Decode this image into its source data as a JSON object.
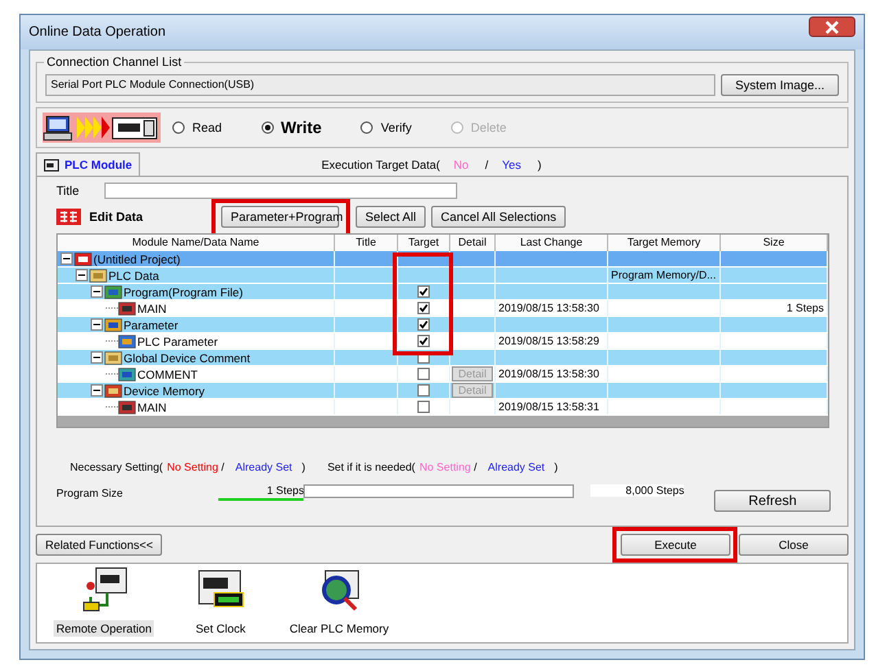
{
  "window": {
    "title": "Online Data Operation"
  },
  "connection": {
    "legend": "Connection Channel List",
    "value": "Serial Port  PLC Module Connection(USB)",
    "button": "System Image..."
  },
  "modes": [
    {
      "label": "Read",
      "selected": false,
      "disabled": false
    },
    {
      "label": "Write",
      "selected": true,
      "disabled": false
    },
    {
      "label": "Verify",
      "selected": false,
      "disabled": false
    },
    {
      "label": "Delete",
      "selected": false,
      "disabled": true
    }
  ],
  "tabs": [
    {
      "label": "PLC Module",
      "selected": true
    }
  ],
  "execution_target": {
    "label": "Execution Target Data(",
    "no": "No",
    "separator": "/",
    "yes": "Yes",
    "close": ")"
  },
  "title_field": {
    "label": "Title"
  },
  "edit_data": {
    "label": "Edit Data"
  },
  "edit_buttons": [
    {
      "label": "Parameter+Program",
      "highlighted": true
    },
    {
      "label": "Select All",
      "highlighted": false
    },
    {
      "label": "Cancel All Selections",
      "highlighted": false
    }
  ],
  "table": {
    "columns": [
      {
        "label": "Module Name/Data Name",
        "highlighted": false
      },
      {
        "label": "Title",
        "highlighted": false
      },
      {
        "label": "Target",
        "highlighted": true
      },
      {
        "label": "Detail",
        "highlighted": false
      },
      {
        "label": "Last Change",
        "highlighted": false
      },
      {
        "label": "Target Memory",
        "highlighted": false
      },
      {
        "label": "Size",
        "highlighted": false
      }
    ],
    "rows": [
      {
        "name": "(Untitled Project)",
        "kind": "project",
        "expanded": true,
        "selected": true,
        "children": [
          {
            "name": "PLC Data",
            "kind": "folder",
            "expanded": true,
            "selected": false,
            "target_memory": "Program Memory/D...",
            "children": [
              {
                "name": "Program(Program File)",
                "kind": "program",
                "expanded": true,
                "selected": false,
                "target": true,
                "children": [
                  {
                    "name": "MAIN",
                    "kind": "program_file",
                    "selected": false,
                    "target": true,
                    "last_change": "2019/08/15 13:58:30",
                    "size": "1 Steps"
                  }
                ]
              },
              {
                "name": "Parameter",
                "kind": "parameter",
                "expanded": true,
                "selected": false,
                "target": true,
                "children": [
                  {
                    "name": "PLC Parameter",
                    "kind": "parameter_file",
                    "selected": false,
                    "target": true,
                    "last_change": "2019/08/15 13:58:29"
                  }
                ]
              },
              {
                "name": "Global Device Comment",
                "kind": "comment",
                "expanded": true,
                "selected": false,
                "target": false,
                "children": [
                  {
                    "name": "COMMENT",
                    "kind": "comment_file",
                    "selected": false,
                    "target": false,
                    "detail": "Detail",
                    "last_change": "2019/08/15 13:58:30"
                  }
                ]
              },
              {
                "name": "Device Memory",
                "kind": "memory",
                "expanded": true,
                "selected": false,
                "target": false,
                "detail": "Detail",
                "children": [
                  {
                    "name": "MAIN",
                    "kind": "memory_file",
                    "selected": false,
                    "target": false,
                    "last_change": "2019/08/15 13:58:31"
                  }
                ]
              }
            ]
          }
        ]
      }
    ]
  },
  "legends": [
    {
      "label": "Necessary Setting(",
      "no_setting": "No Setting",
      "color": "#ff0000",
      "separator": "/",
      "already_set": "Already Set",
      "close": ")"
    },
    {
      "label": "Set if it is needed(",
      "no_setting": "No Setting",
      "color": "#ff66cc",
      "separator": "/",
      "already_set": "Already Set",
      "close": ")"
    }
  ],
  "program_size": {
    "label": "Program Size",
    "used": "1 Steps",
    "capacity": "8,000 Steps"
  },
  "refresh": "Refresh",
  "related": "Related Functions<<",
  "footer_buttons": [
    {
      "label": "Execute",
      "highlighted": true
    },
    {
      "label": "Close",
      "highlighted": false
    }
  ],
  "functions": [
    {
      "label": "Remote Operation",
      "kind": "remote",
      "selected": true
    },
    {
      "label": "Set Clock",
      "kind": "clock",
      "selected": false
    },
    {
      "label": "Clear PLC Memory",
      "kind": "clear",
      "selected": false
    }
  ]
}
